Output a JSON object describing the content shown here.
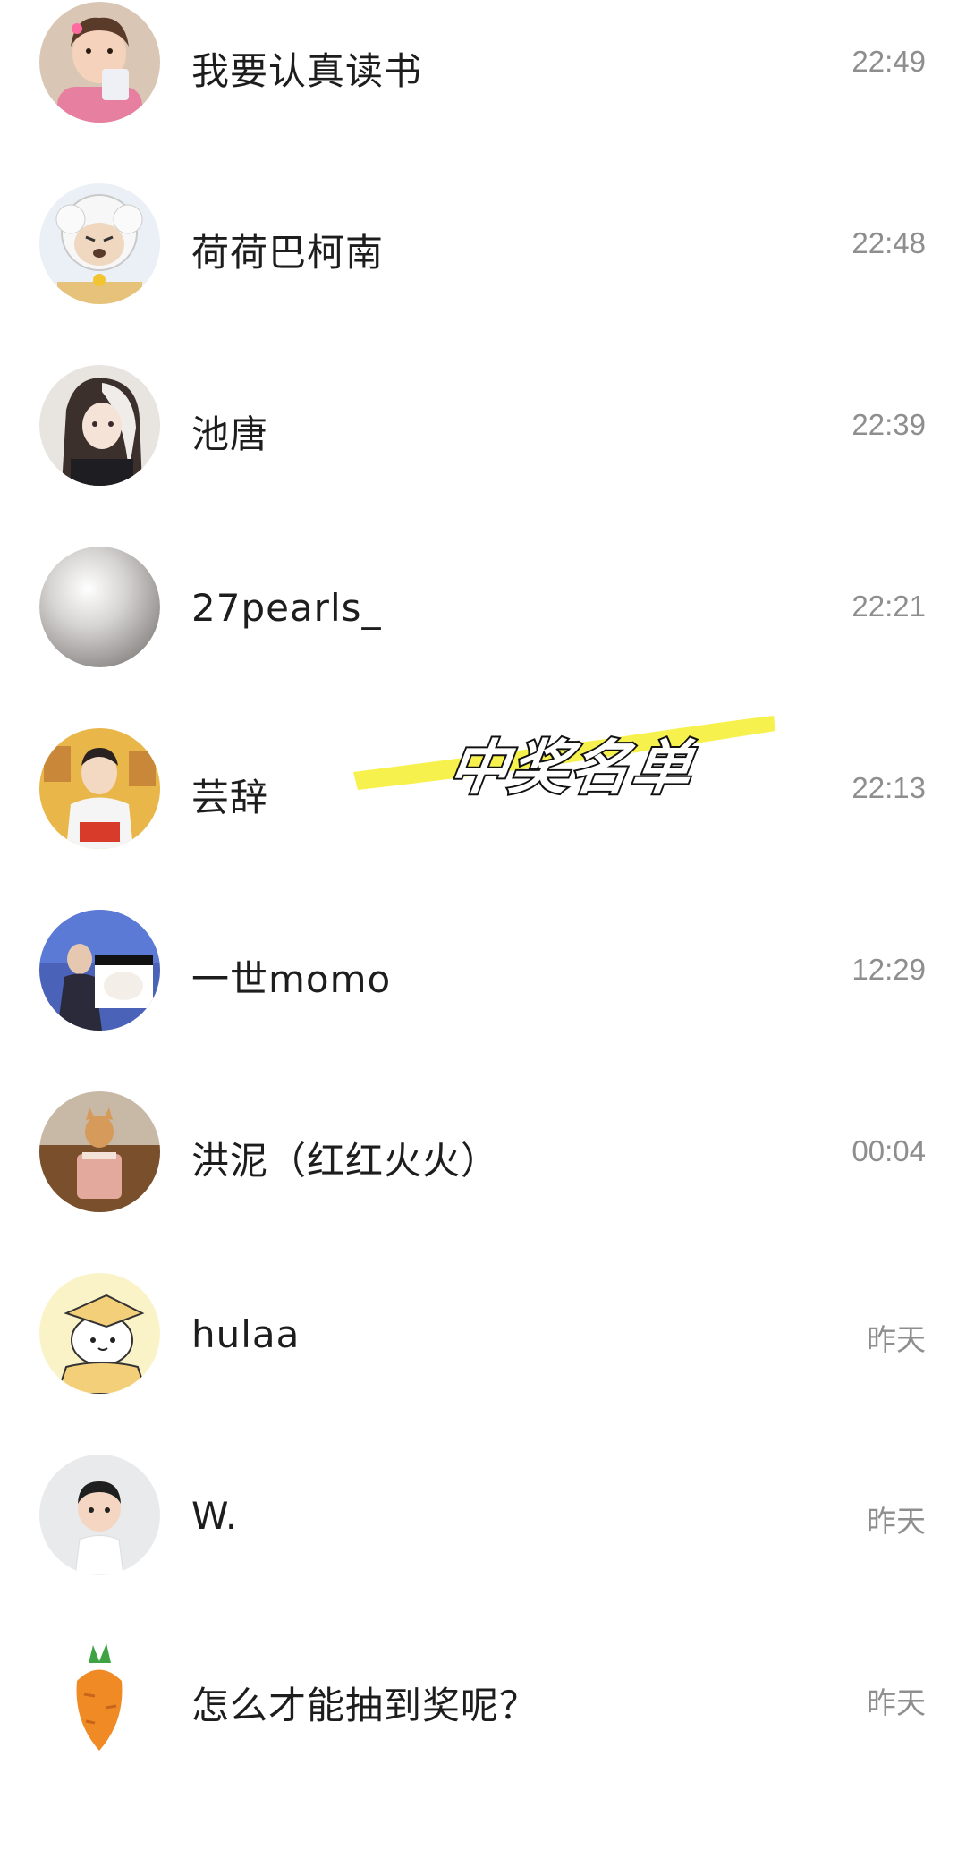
{
  "chats": [
    {
      "name": "我要认真读书",
      "time": "22:49",
      "avatar_icon": "girl-photo-avatar"
    },
    {
      "name": "荷荷巴柯南",
      "time": "22:48",
      "avatar_icon": "cartoon-sheep-avatar"
    },
    {
      "name": "池唐",
      "time": "22:39",
      "avatar_icon": "anime-girl-avatar"
    },
    {
      "name": "27pearls_",
      "time": "22:21",
      "avatar_icon": "pearl-avatar"
    },
    {
      "name": "芸辞",
      "time": "22:13",
      "avatar_icon": "man-photo-avatar"
    },
    {
      "name": "一世momo",
      "time": "12:29",
      "avatar_icon": "stage-photo-avatar"
    },
    {
      "name": "洪泥（红红火火）",
      "time": "00:04",
      "avatar_icon": "cat-drink-avatar"
    },
    {
      "name": "hulaa",
      "time": "昨天",
      "avatar_icon": "cartoon-dog-graduate-avatar"
    },
    {
      "name": "W.",
      "time": "昨天",
      "avatar_icon": "cartoon-boy-avatar"
    },
    {
      "name": "怎么才能抽到奖呢？",
      "time": "昨天",
      "avatar_icon": "carrot-avatar"
    }
  ],
  "overlay": {
    "label": "中奖名单",
    "highlight_color": "#f5ef3a"
  }
}
